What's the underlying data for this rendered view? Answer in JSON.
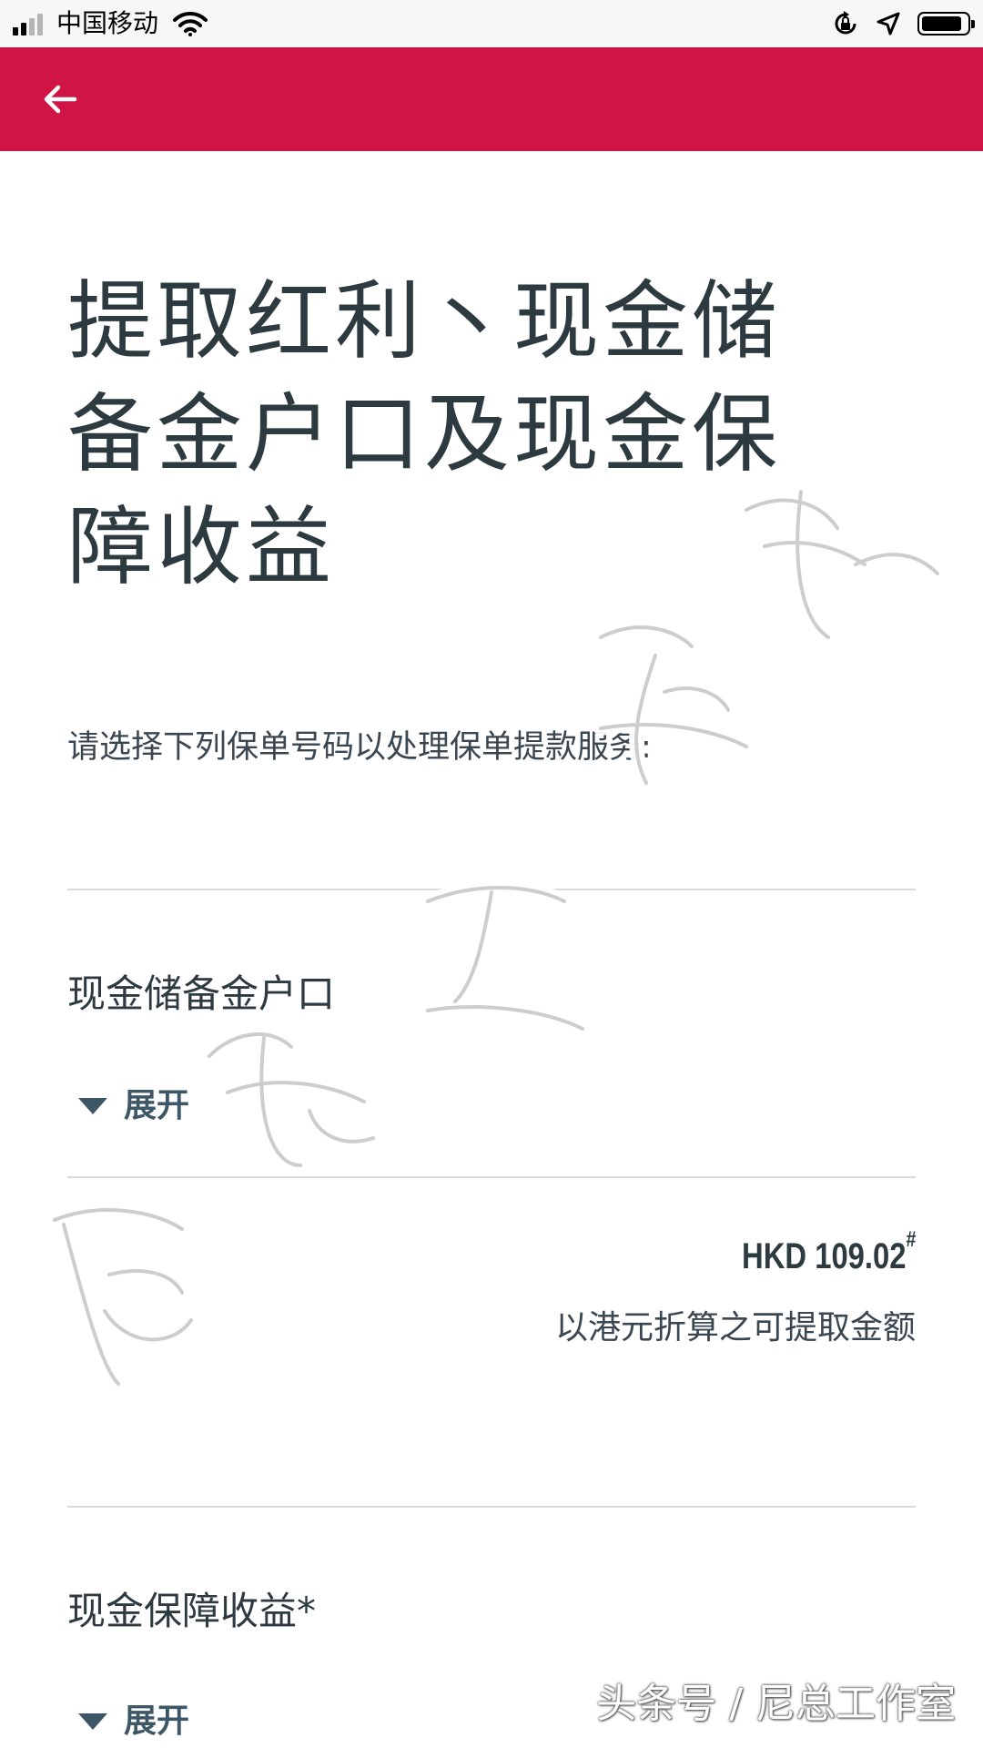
{
  "status_bar": {
    "carrier": "中国移动",
    "signal_bars_active": 2,
    "signal_bars_total": 4,
    "icons": [
      "signal-icon",
      "wifi-icon",
      "rotation-lock-icon",
      "location-arrow-icon",
      "battery-icon"
    ],
    "battery_level": 0.9
  },
  "header": {
    "back_icon": "arrow-left-icon",
    "color": "#d11446"
  },
  "page": {
    "title": "提取红利丶现金储备金户口及现金保障收益",
    "instruction": "请选择下列保单号码以处理保单提款服务:"
  },
  "sections": [
    {
      "title": "现金储备金户口",
      "expand_label": "展开",
      "amount": "HKD 109.02",
      "amount_mark": "#",
      "amount_caption": "以港元折算之可提取金额"
    },
    {
      "title": "现金保障收益*",
      "expand_label": "展开"
    }
  ],
  "watermark": {
    "text": "头条号 / 尼总工作室"
  }
}
